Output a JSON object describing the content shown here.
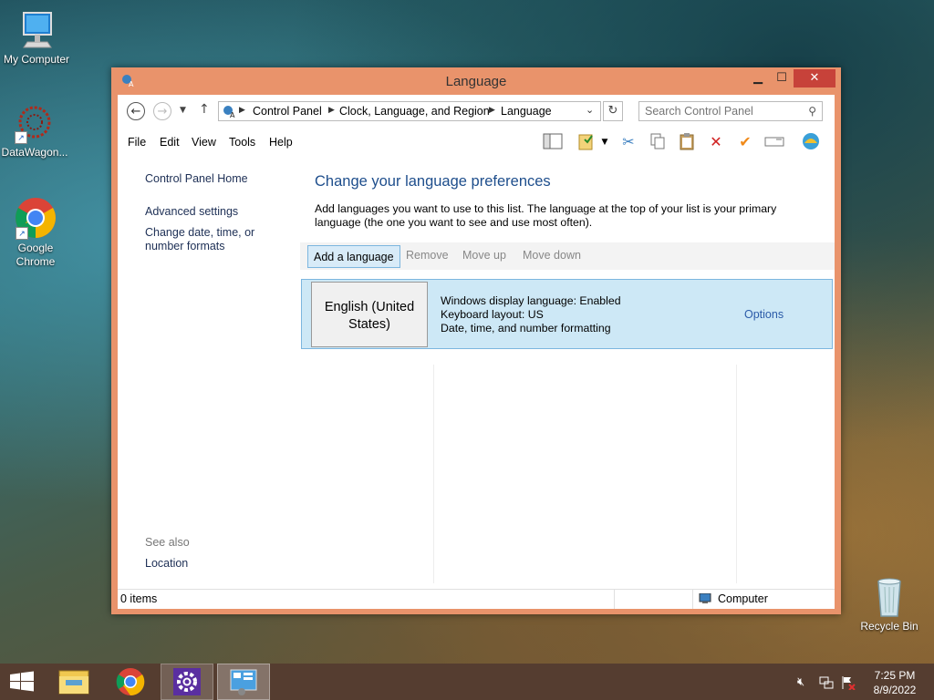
{
  "desktop": {
    "icons": [
      {
        "label": "My Computer",
        "icon": "my-computer-icon"
      },
      {
        "label": "DataWagon...",
        "icon": "datawagon-icon"
      },
      {
        "label": "Google Chrome",
        "icon": "chrome-icon"
      },
      {
        "label": "Recycle Bin",
        "icon": "recycle-bin-icon"
      }
    ]
  },
  "window": {
    "title": "Language",
    "breadcrumb": [
      "Control Panel",
      "Clock, Language, and Region",
      "Language"
    ],
    "search_placeholder": "Search Control Panel",
    "menu": [
      "File",
      "Edit",
      "View",
      "Tools",
      "Help"
    ],
    "left_pane": {
      "home": "Control Panel Home",
      "links": [
        "Advanced settings",
        "Change date, time, or number formats"
      ],
      "see_also_heading": "See also",
      "see_also": [
        "Location"
      ]
    },
    "main": {
      "heading": "Change your language preferences",
      "description": "Add languages you want to use to this list. The language at the top of your list is your primary language (the one you want to see and use most often).",
      "actions": [
        "Add a language",
        "Remove",
        "Move up",
        "Move down"
      ],
      "languages": [
        {
          "name": "English (United States)",
          "details": [
            "Windows display language: Enabled",
            "Keyboard layout: US",
            "Date, time, and number formatting"
          ],
          "options_label": "Options"
        }
      ]
    },
    "status": {
      "items": "0 items",
      "location": "Computer"
    }
  },
  "taskbar": {
    "time": "7:25 PM",
    "date": "8/9/2022",
    "pinned": [
      "start-button",
      "file-explorer",
      "chrome",
      "settings",
      "control-panel"
    ]
  },
  "colors": {
    "window_frame": "#e9936b",
    "close_button": "#c7423a",
    "selection": "#cde8f6",
    "link": "#1e4e8c"
  }
}
